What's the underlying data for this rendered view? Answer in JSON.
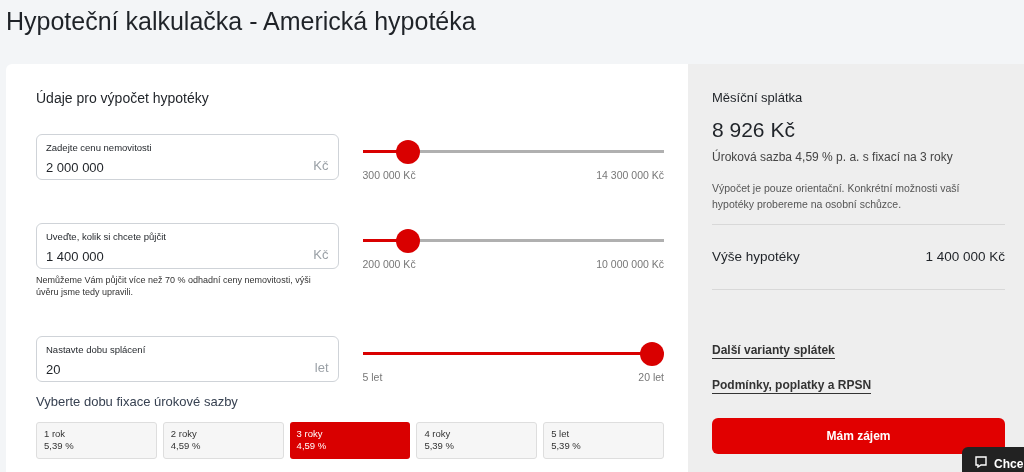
{
  "page_title": "Hypoteční kalkulačka - Americká hypotéka",
  "form": {
    "heading": "Údaje pro výpočet hypotéky",
    "inputs": [
      {
        "label": "Zadejte cenu nemovitosti",
        "value": "2 000 000",
        "unit": "Kč",
        "slider": {
          "level": 0.12,
          "min_label": "300 000 Kč",
          "max_label": "14 300 000 Kč"
        }
      },
      {
        "label": "Uveďte, kolik si chcete půjčit",
        "value": "1 400 000",
        "unit": "Kč",
        "note": "Nemůžeme Vám půjčit více než 70 % odhadní ceny nemovitosti, výši úvěru jsme tedy upravili.",
        "slider": {
          "level": 0.12,
          "min_label": "200 000 Kč",
          "max_label": "10 000 000 Kč"
        }
      },
      {
        "label": "Nastavte dobu splácení",
        "value": "20",
        "unit": "let",
        "slider": {
          "level": 1,
          "min_label": "5 let",
          "max_label": "20 let"
        }
      }
    ],
    "fixation_heading": "Vyberte dobu fixace úrokové sazby",
    "fixation_options": [
      {
        "period": "1 rok",
        "rate": "5,39 %",
        "selected": false
      },
      {
        "period": "2 roky",
        "rate": "4,59 %",
        "selected": false
      },
      {
        "period": "3 roky",
        "rate": "4,59 %",
        "selected": true
      },
      {
        "period": "4 roky",
        "rate": "5,39 %",
        "selected": false
      },
      {
        "period": "5 let",
        "rate": "5,39 %",
        "selected": false
      }
    ]
  },
  "summary": {
    "label": "Měsíční splátka",
    "amount": "8 926 Kč",
    "rate_text": "Úroková sazba 4,59 % p. a. s fixací na 3 roky",
    "disclaimer": "Výpočet je pouze orientační. Konkrétní možnosti vaší hypotéky probereme na osobní schůzce.",
    "loan_label": "Výše hypotéky",
    "loan_value": "1 400 000 Kč",
    "links": [
      "Další varianty splátek",
      "Podmínky, poplatky a RPSN"
    ],
    "button": "Mám zájem"
  },
  "chat_widget": {
    "label": "Chce"
  }
}
